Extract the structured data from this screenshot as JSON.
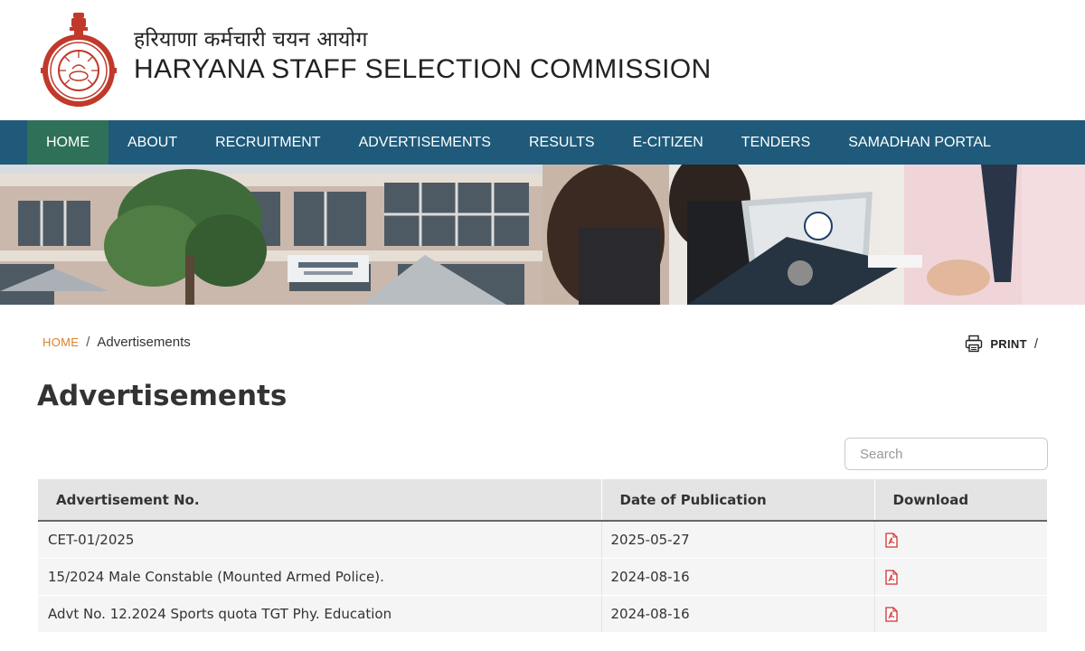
{
  "header": {
    "title_hindi": "हरियाणा कर्मचारी चयन आयोग",
    "title_english": "HARYANA STAFF SELECTION COMMISSION",
    "emblem_icon": "haryana-govt-emblem"
  },
  "nav": {
    "items": [
      {
        "label": "HOME",
        "active": true
      },
      {
        "label": "ABOUT"
      },
      {
        "label": "RECRUITMENT"
      },
      {
        "label": "ADVERTISEMENTS"
      },
      {
        "label": "RESULTS"
      },
      {
        "label": "E-CITIZEN"
      },
      {
        "label": "TENDERS"
      },
      {
        "label": "SAMADHAN PORTAL"
      }
    ]
  },
  "breadcrumb": {
    "home": "HOME",
    "separator": "/",
    "current": "Advertisements"
  },
  "print": {
    "label": "PRINT",
    "separator": "/",
    "icon": "printer-icon"
  },
  "page_title": "Advertisements",
  "search": {
    "placeholder": "Search",
    "value": ""
  },
  "table": {
    "headers": [
      "Advertisement No.",
      "Date of Publication",
      "Download"
    ],
    "rows": [
      {
        "advertisement": "CET-01/2025",
        "date": "2025-05-27",
        "download_icon": "pdf-icon"
      },
      {
        "advertisement": "15/2024 Male Constable (Mounted Armed Police).",
        "date": "2024-08-16",
        "download_icon": "pdf-icon"
      },
      {
        "advertisement": "Advt No. 12.2024 Sports quota TGT Phy. Education",
        "date": "2024-08-16",
        "download_icon": "pdf-icon"
      }
    ]
  },
  "colors": {
    "nav_bg": "#1f5a7a",
    "nav_active_bg": "#2e7058",
    "breadcrumb_home": "#d9822b",
    "pdf_icon": "#d32f2f"
  }
}
